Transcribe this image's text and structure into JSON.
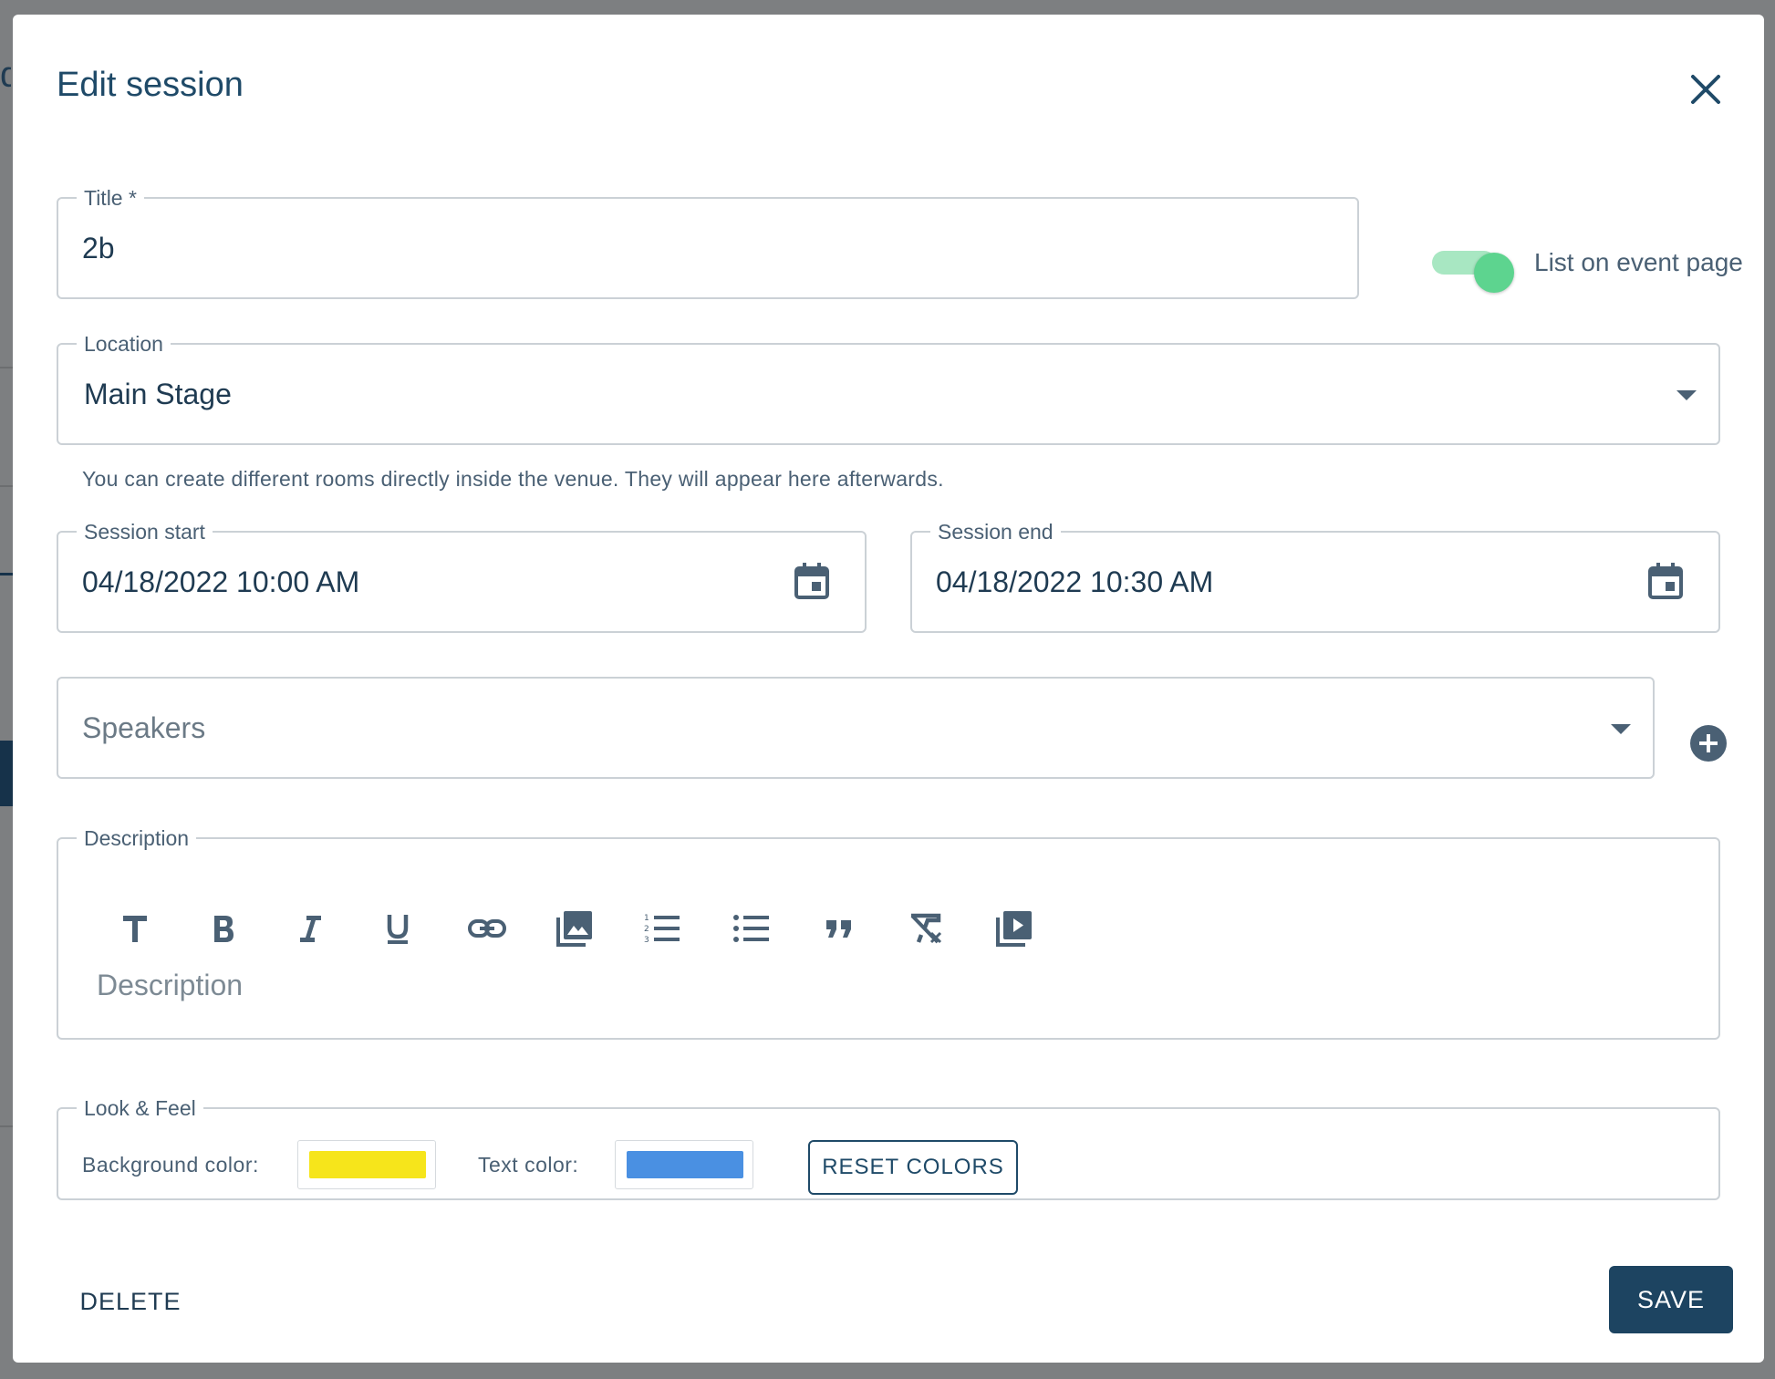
{
  "dialog": {
    "title": "Edit session"
  },
  "form": {
    "title": {
      "label": "Title *",
      "value": "2b"
    },
    "list_toggle": {
      "label": "List on event page",
      "checked": true
    },
    "location": {
      "label": "Location",
      "value": "Main Stage",
      "helper": "You can create different rooms directly inside the venue. They will appear here afterwards."
    },
    "session_start": {
      "label": "Session start",
      "value": "04/18/2022 10:00 AM"
    },
    "session_end": {
      "label": "Session end",
      "value": "04/18/2022 10:30 AM"
    },
    "speakers": {
      "placeholder": "Speakers"
    },
    "description": {
      "label": "Description",
      "placeholder": "Description",
      "toolbar": [
        "heading-icon",
        "bold-icon",
        "italic-icon",
        "underline-icon",
        "link-icon",
        "image-icon",
        "numbered-list-icon",
        "bullet-list-icon",
        "quote-icon",
        "clear-format-icon",
        "video-icon"
      ]
    },
    "look_feel": {
      "label": "Look & Feel",
      "background_label": "Background color:",
      "background_color": "#f6e51b",
      "text_label": "Text color:",
      "text_color": "#4a90e2",
      "reset_label": "RESET COLORS"
    }
  },
  "actions": {
    "delete_label": "DELETE",
    "save_label": "SAVE"
  },
  "colors": {
    "primary": "#1d4461",
    "toggle_on": "#5dd48f"
  }
}
